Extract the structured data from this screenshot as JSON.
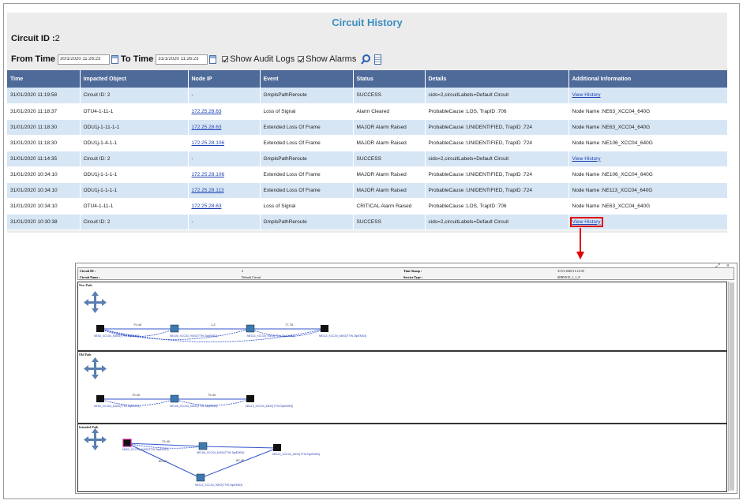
{
  "header": {
    "title": "Circuit History"
  },
  "circuit": {
    "label": "Circuit ID :",
    "value": "2"
  },
  "filters": {
    "from_label": "From Time",
    "from_value": "30/1/2020 11:26:23",
    "to_label": "To Time",
    "to_value": "31/1/2020 11:26:23",
    "audit_label": "Show Audit Logs",
    "alarms_label": "Show Alarms"
  },
  "table": {
    "columns": [
      "Time",
      "Impacted Object",
      "Node IP",
      "Event",
      "Status",
      "Details",
      "Additional Information"
    ],
    "rows": [
      [
        "31/01/2020 11:19:58",
        "Circuit ID: 2",
        "-",
        "GmplsPathReroute",
        "SUCCESS",
        "cids=2,circuitLabels=Default Circuit",
        "View History"
      ],
      [
        "31/01/2020 11:18:37",
        "OTU4-1-11-1",
        "172.25.28.63",
        "Loss of Signal",
        "Alarm Cleared",
        "ProbableCause :LOS, TrapID :706",
        "Node Name :NE63_XCC04_640G"
      ],
      [
        "31/01/2020 11:18:30",
        "ODU1j-1-11-1-1",
        "172.25.28.63",
        "Extended Loss Of Frame",
        "MAJOR Alarm Raised",
        "ProbableCause :UNIDENTIFIED, TrapID :724",
        "Node Name :NE63_XCC04_640G"
      ],
      [
        "31/01/2020 11:18:30",
        "ODU1j-1-4-1-1",
        "172.25.28.106",
        "Extended Loss Of Frame",
        "MAJOR Alarm Raised",
        "ProbableCause :UNIDENTIFIED, TrapID :724",
        "Node Name :NE106_XCC04_640G"
      ],
      [
        "31/01/2020 11:14:35",
        "Circuit ID: 2",
        "-",
        "GmplsPathReroute",
        "SUCCESS",
        "cids=2,circuitLabels=Default Circuit",
        "View History"
      ],
      [
        "31/01/2020 10:34:10",
        "ODU1j-1-1-1-1",
        "172.25.28.106",
        "Extended Loss Of Frame",
        "MAJOR Alarm Raised",
        "ProbableCause :UNIDENTIFIED, TrapID :724",
        "Node Name :NE106_XCC04_640G"
      ],
      [
        "31/01/2020 10:34:10",
        "ODU1j-1-1-1-1",
        "172.25.28.113",
        "Extended Loss Of Frame",
        "MAJOR Alarm Raised",
        "ProbableCause :UNIDENTIFIED, TrapID :724",
        "Node Name :NE113_XCC04_640G"
      ],
      [
        "31/01/2020 10:34:10",
        "OTU4-1-11-1",
        "172.25.28.63",
        "Loss of Signal",
        "CRITICAL Alarm Raised",
        "ProbableCause :LOS, TrapID :706",
        "Node Name :NE63_XCC04_640G"
      ],
      [
        "31/01/2020 10:30:38",
        "Circuit ID: 2",
        "-",
        "GmplsPathReroute",
        "SUCCESS",
        "cids=2,circuitLabels=Default Circuit",
        "View History"
      ]
    ],
    "row_styles": [
      "blue",
      "white",
      "blue",
      "white",
      "blue",
      "white",
      "blue",
      "white",
      "blue"
    ]
  },
  "popup": {
    "controls": "_ ⤢ ×",
    "circuit_id_label": "Circuit ID :",
    "circuit_id_value": "2",
    "timestamp_label": "Time Stamp :",
    "timestamp_value": "31-01-2020 11:14:35",
    "circuit_name_label": "Circuit Name :",
    "circuit_name_value": "Default Circuit",
    "service_type_label": "Service Type :",
    "service_type_value": "SERVICE_1_1_F",
    "panels": [
      {
        "title": "New Path",
        "nodes": [
          "NE63_XCC04_640G(TTHLTapEMS3)",
          "NE106_XCC04_900G(TTHLTapEMS3)",
          "NE113_XCC04_900G(TTHLTapEMS3)",
          "NE113_XCC04_640G(TTHLTapEMS3)"
        ],
        "links": [
          "79-40",
          "1-2",
          "77-78"
        ]
      },
      {
        "title": "Old Path",
        "nodes": [
          "NE63_XCC04_640G(TTHLTapEMS3)",
          "NE106_XCC04_900G(TTHLTapEMS3)",
          "NE113_XCC04_640G(TTHLTapEMS3)"
        ],
        "links": [
          "79-40",
          "79-40"
        ]
      },
      {
        "title": "Intended Path",
        "nodes": [
          "NE63_XCC04_640G(TTHLTapEMS3)",
          "NE106_XCC04_640G(TTHLTapEMS3)",
          "NE113_XCC04_640G(TTHLTapEMS3)",
          "NE113_XCC04_900G(TTHLTapEMS3)"
        ],
        "links": [
          "79-40",
          "80-60",
          "80-40"
        ]
      }
    ]
  },
  "colors": {
    "header_bg": "#4e6a99",
    "row_blue": "#d7e6f5",
    "title": "#3a8ec0",
    "highlight": "#e00000"
  }
}
